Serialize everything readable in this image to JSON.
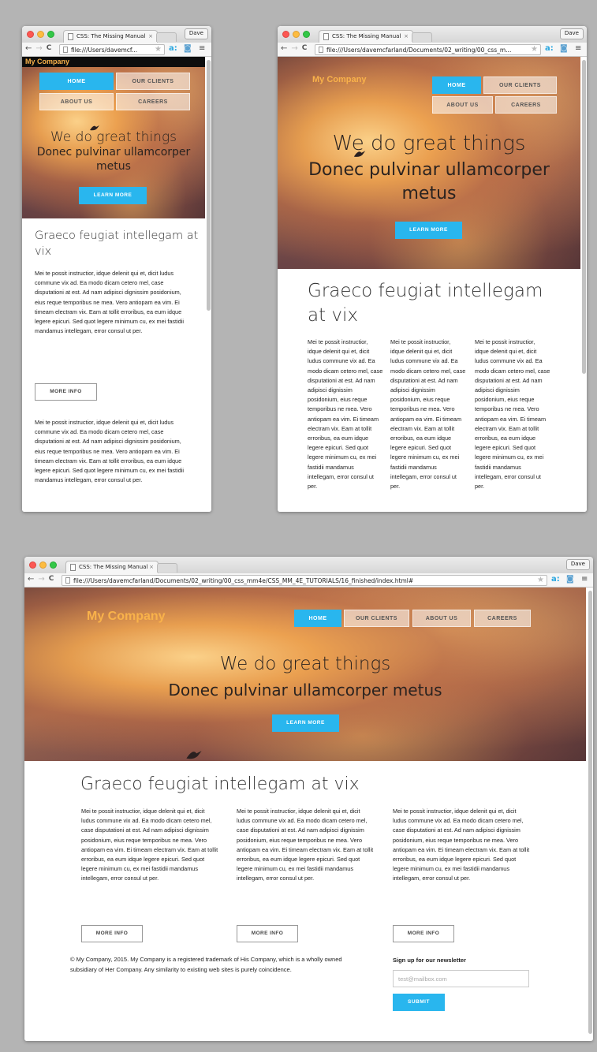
{
  "browser": {
    "tab_title": "CSS: The Missing Manual",
    "tab_close": "×",
    "profile": "Dave",
    "url_short": "file:///Users/davemcf...",
    "url_mid": "file:///Users/davemcfarland/Documents/02_writing/00_css_m...",
    "url_full": "file:///Users/davemcfarland/Documents/02_writing/00_css_mm4e/CSS_MM_4E_TUTORIALS/16_finished/index.html#",
    "back": "←",
    "forward": "→",
    "reload": "C",
    "star": "★",
    "menu": "≡"
  },
  "site": {
    "logo": "My Company",
    "nav": {
      "home": "HOME",
      "clients": "OUR CLIENTS",
      "about": "ABOUT US",
      "careers": "CAREERS"
    },
    "hero_title": "We do great things",
    "hero_sub": "Donec pulvinar ullamcorper metus",
    "hero_title_break": "Donec pulvinar ullamcorper",
    "hero_title_break2": "metus",
    "cta": "LEARN MORE",
    "section_title": "Graeco feugiat intellegam at vix",
    "section_title_l1": "Graeco feugiat intellegam at",
    "section_title_l2": "vix",
    "section_title_m1": "Graeco feugiat intellegam",
    "section_title_m2": "at vix",
    "para": "Mei te possit instructior, idque delenit qui et, dicit ludus commune vix ad. Ea modo dicam cetero mel, case disputationi at est. Ad nam adipisci dignissim posidonium, eius reque temporibus ne mea. Vero antiopam ea vim. Ei timeam electram vix. Eam at tollit erroribus, ea eum idque legere epicuri. Sed quot legere minimum cu, ex mei fastidii mandamus intellegam, error consul ut per.",
    "more_info": "MORE INFO",
    "footer_text": "© My Company, 2015. My Company is a registered trademark of His Company, which is a wholly owned subsidiary of Her Company. Any similarity to existing web sites is purely coincidence.",
    "newsletter_heading": "Sign up for our newsletter",
    "newsletter_placeholder": "test@mailbox.com",
    "submit": "SUBMIT"
  },
  "colors": {
    "accent": "#29b6ee",
    "logo": "#f9b24a",
    "page_bg": "#b4b4b4"
  }
}
